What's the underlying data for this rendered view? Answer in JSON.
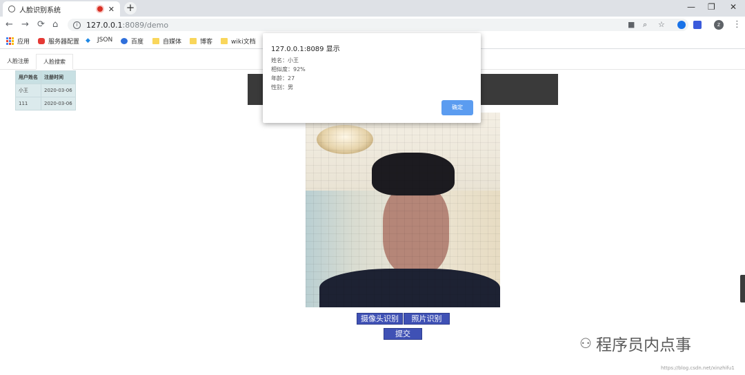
{
  "browser": {
    "tab_title": "人脸识别系统",
    "new_tab": "+",
    "tab_close": "✕",
    "window_controls": [
      "—",
      "❐",
      "✕"
    ],
    "url_host": "127.0.0.1",
    "url_path": ":8089/demo",
    "nav": {
      "back": "←",
      "forward": "→",
      "reload": "⟳",
      "home": "⌂"
    },
    "omni_icons": [
      "camera-icon",
      "zoom-icon",
      "star-icon"
    ],
    "profile_initial": "z",
    "menu": "⋮"
  },
  "bookmarks": [
    {
      "label": "应用",
      "icon": "apps-icon"
    },
    {
      "label": "服务器配置",
      "icon": "server-icon"
    },
    {
      "label": "JSON",
      "icon": "json-icon"
    },
    {
      "label": "百度",
      "icon": "baidu-icon"
    },
    {
      "label": "自媒体",
      "icon": "folder-icon"
    },
    {
      "label": "博客",
      "icon": "folder-icon"
    },
    {
      "label": "wiki文档",
      "icon": "folder-icon"
    }
  ],
  "page": {
    "tabs": [
      "人脸注册",
      "人脸搜索"
    ],
    "active_tab": "人脸搜索",
    "table": {
      "headers": [
        "用户姓名",
        "注册时间"
      ],
      "rows": [
        [
          "小王",
          "2020-03-06"
        ],
        [
          "111",
          "2020-03-06"
        ]
      ]
    },
    "buttons": {
      "camera": "摄像头识别",
      "photo": "照片识别",
      "submit": "提交"
    }
  },
  "dialog": {
    "title": "127.0.0.1:8089 显示",
    "lines": [
      "姓名：小王",
      "相似度：92%",
      "年龄：27",
      "性别：男"
    ],
    "ok": "确定"
  },
  "watermark": {
    "text": "程序员内点事",
    "url": "https://blog.csdn.net/xinzhifu1"
  },
  "colors": {
    "accent": "#3f51b5",
    "dialog_button": "#5b9cf0",
    "table_header": "#c8e0e3"
  }
}
